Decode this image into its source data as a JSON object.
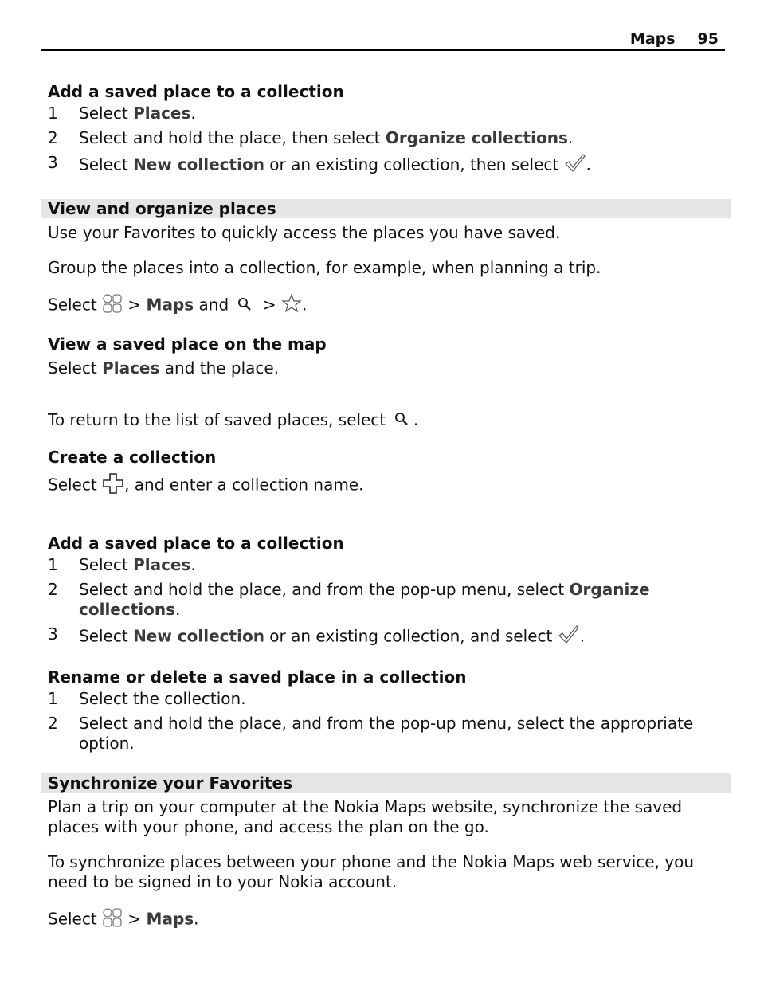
{
  "header": {
    "chapter": "Maps",
    "page": "95"
  },
  "sec1": {
    "title": "Add a saved place to a collection",
    "steps": [
      {
        "n": "1",
        "pre": "Select ",
        "bold": "Places",
        "post": "."
      },
      {
        "n": "2",
        "pre": "Select and hold the place, then select ",
        "bold": "Organize collections",
        "post": "."
      },
      {
        "n": "3",
        "pre": "Select ",
        "bold": "New collection",
        "mid": " or an existing collection, then select ",
        "post": "."
      }
    ]
  },
  "view": {
    "title": "View and organize places",
    "p1": "Use your Favorites to quickly access the places you have saved.",
    "p2": "Group the places into a collection, for example, when planning a trip.",
    "select_pre": "Select ",
    "gt": " > ",
    "maps": "Maps",
    "and": " and ",
    "gt2": " > ",
    "end": "."
  },
  "viewmap": {
    "title": "View a saved place on the map",
    "pre": "Select ",
    "bold": "Places",
    "post": " and the place.",
    "ret": "To return to the list of saved places, select ",
    "ret_end": " ."
  },
  "create": {
    "title": "Create a collection",
    "pre": "Select ",
    "post": ", and enter a collection name."
  },
  "sec2": {
    "title": "Add a saved place to a collection",
    "steps": [
      {
        "n": "1",
        "pre": "Select ",
        "bold": "Places",
        "post": "."
      },
      {
        "n": "2",
        "pre": "Select and hold the place, and from the pop-up menu, select ",
        "bold": "Organize collections",
        "post": "."
      },
      {
        "n": "3",
        "pre": "Select ",
        "bold": "New collection",
        "mid": " or an existing collection, and select ",
        "post": "."
      }
    ]
  },
  "rename": {
    "title": "Rename or delete a saved place in a collection",
    "steps": [
      {
        "n": "1",
        "text": "Select the collection."
      },
      {
        "n": "2",
        "text": "Select and hold the place, and from the pop-up menu, select the appropriate option."
      }
    ]
  },
  "sync": {
    "title": "Synchronize your Favorites",
    "p1": "Plan a trip on your computer at the Nokia Maps website, synchronize the saved places with your phone, and access the plan on the go.",
    "p2": "To synchronize places between your phone and the Nokia Maps web service, you need to be signed in to your Nokia account.",
    "select_pre": "Select ",
    "gt": " > ",
    "maps": "Maps",
    "end": "."
  },
  "icons": {
    "menu": "app-menu-icon",
    "search": "search-icon",
    "star": "star-icon",
    "check": "checkmark-icon",
    "plus": "plus-icon"
  }
}
